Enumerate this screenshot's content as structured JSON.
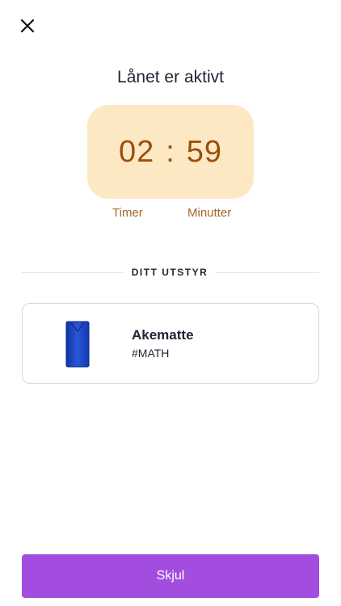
{
  "header": {
    "close_icon": "close-icon",
    "title": "Lånet er aktivt"
  },
  "timer": {
    "hours": "02",
    "separator": ":",
    "minutes": "59",
    "hours_label": "Timer",
    "minutes_label": "Minutter",
    "background_color": "#fde8c4",
    "text_color": "#9a4f0e"
  },
  "equipment": {
    "section_label": "DITT UTSTYR",
    "items": [
      {
        "image_icon": "sled-mat-image",
        "name": "Akematte",
        "tag": "#MATH"
      }
    ]
  },
  "footer": {
    "hide_label": "Skjul",
    "button_color": "#a24de0"
  }
}
